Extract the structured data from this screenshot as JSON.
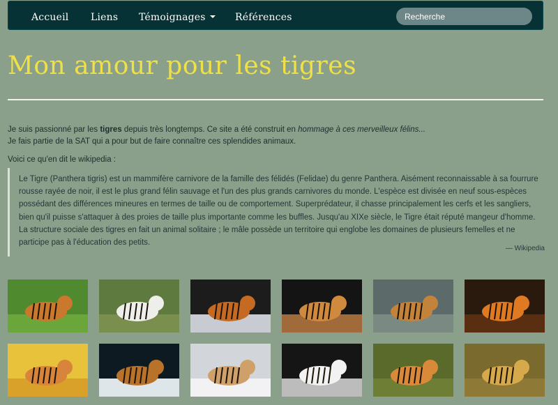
{
  "nav": {
    "items": [
      {
        "label": "Accueil"
      },
      {
        "label": "Liens"
      },
      {
        "label": "Témoignages"
      },
      {
        "label": "Références"
      }
    ],
    "search_placeholder": "Recherche"
  },
  "header": {
    "title": "Mon amour pour les tigres"
  },
  "intro": {
    "p1_a": "Je suis passionné par les ",
    "p1_bold": "tigres",
    "p1_b": " depuis très longtemps. Ce site a été construit en ",
    "p1_italic": "hommage à ces merveilleux félins...",
    "p2": "Je fais partie de la SAT qui a pour but de faire connaître ces splendides animaux.",
    "p3": "Voici ce qu'en dit le wikipedia :"
  },
  "quote": {
    "text": "Le Tigre (Panthera tigris) est un mammifère carnivore de la famille des félidés (Felidae) du genre Panthera. Aisément reconnaissable à sa fourrure rousse rayée de noir, il est le plus grand félin sauvage et l'un des plus grands carnivores du monde. L'espèce est divisée en neuf sous-espèces possédant des différences mineures en termes de taille ou de comportement. Superprédateur, il chasse principalement les cerfs et les sangliers, bien qu'il puisse s'attaquer à des proies de taille plus importante comme les buffles. Jusqu'au XIXe siècle, le Tigre était réputé mangeur d'homme. La structure sociale des tigres en fait un animal solitaire ; le mâle possède un territoire qui englobe les domaines de plusieurs femelles et ne participe pas à l'éducation des petits.",
    "source": "— Wikipedia"
  },
  "colors": {
    "background": "#8aa08a",
    "navbar": "#073235",
    "title": "#f0e047",
    "search": "#6d8688"
  },
  "gallery": [
    {
      "bg": "#4f8a2e",
      "ground": "#6aa63a",
      "fur": "#c9782e"
    },
    {
      "bg": "#5f7a3e",
      "ground": "#7a8e4e",
      "fur": "#eeeeea"
    },
    {
      "bg": "#1c1c1c",
      "ground": "#c8ccd2",
      "fur": "#c46a22"
    },
    {
      "bg": "#141414",
      "ground": "#a06a3a",
      "fur": "#d08a3e"
    },
    {
      "bg": "#5d6a6a",
      "ground": "#7a8a82",
      "fur": "#c4833a"
    },
    {
      "bg": "#2a1a0e",
      "ground": "#5a2e10",
      "fur": "#e07a22"
    },
    {
      "bg": "#e8c23a",
      "ground": "#d9a02a",
      "fur": "#d8843a"
    },
    {
      "bg": "#0e1a22",
      "ground": "#dfe6ea",
      "fur": "#b8722a"
    },
    {
      "bg": "#d2d6da",
      "ground": "#f2f2f4",
      "fur": "#cfa06a"
    },
    {
      "bg": "#151515",
      "ground": "#bcbcbc",
      "fur": "#f2f2f2"
    },
    {
      "bg": "#5a6a2a",
      "ground": "#6e7e34",
      "fur": "#d88a3a"
    },
    {
      "bg": "#7a6a2e",
      "ground": "#8e7a36",
      "fur": "#d6a94a"
    }
  ]
}
